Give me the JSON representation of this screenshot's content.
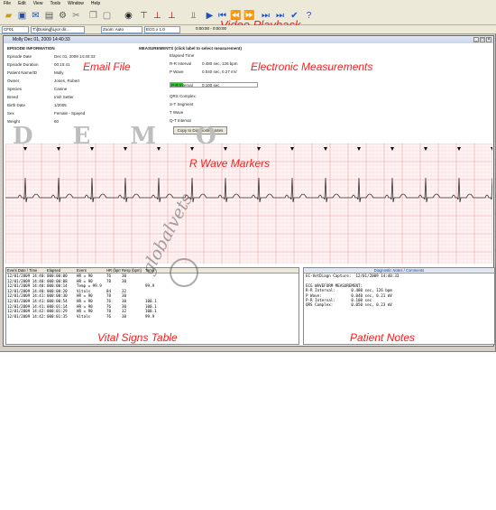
{
  "menu": [
    "File",
    "Edit",
    "View",
    "Tools",
    "Window",
    "Help"
  ],
  "annotations": {
    "video": "Video Playback",
    "email": "Email File",
    "measurements": "Electronic Measurements",
    "rwave": "R Wave Markers",
    "vitals": "Vital Signs Table",
    "notes": "Patient Notes"
  },
  "addressbar": {
    "box1": "CF01",
    "box2": "T:\\[Dosing]\\Lyor dir...",
    "box3": "Zoom: Auto",
    "box4": "ECG x 1.0",
    "time": "0:00:00 - 0:00:00"
  },
  "window": {
    "title": "Molly Dec 01, 2009 14:40:33"
  },
  "episode": {
    "heading": "EPISODE INFORMATION",
    "fields": [
      {
        "label": "Episode Date",
        "value": "Dec 01, 2009 14:40:33"
      },
      {
        "label": "Episode Duration",
        "value": "00:10:41"
      },
      {
        "label": "Patient Name/ID",
        "value": "Molly"
      },
      {
        "label": "Owner",
        "value": "Jones, Robert"
      },
      {
        "label": "Species",
        "value": "Canine"
      },
      {
        "label": "Breed",
        "value": "Irish Setter"
      },
      {
        "label": "Birth Date",
        "value": "1/2005"
      },
      {
        "label": "Sex",
        "value": "Female - Spayed"
      },
      {
        "label": "Weight",
        "value": "60"
      }
    ]
  },
  "measurements": {
    "heading": "MEASUREMENTS (click label to select measurement)",
    "items": [
      {
        "label": "Elapsed Time",
        "value": ""
      },
      {
        "label": "R-R Interval",
        "value": "0.480 sec, 126 bpm"
      },
      {
        "label": "P Wave",
        "value": "0.040 sec, 0.27 mV"
      },
      {
        "label": "P-R Interval",
        "value": "0.100 sec"
      },
      {
        "label": "QRS Complex",
        "value": ""
      },
      {
        "label": "S-T Segment",
        "value": ""
      },
      {
        "label": "T Wave",
        "value": ""
      },
      {
        "label": "Q-T Interval",
        "value": ""
      }
    ],
    "copy_button": "Copy to Diagnostic Notes"
  },
  "demo_text": "DEMO",
  "vitals": {
    "headers": [
      "Event Date / Time",
      "Elapsed",
      "Event",
      "HR (bpm)",
      "Resp (bpm)",
      "Temp"
    ],
    "rows": [
      [
        "12/01/2009 14:40:33",
        "000:00:00",
        "HR = 90",
        "76",
        "30",
        ""
      ],
      [
        "12/01/2009 14:40:39",
        "000:00:08",
        "HR = 90",
        "78",
        "30",
        ""
      ],
      [
        "12/01/2009 14:40:48",
        "000:00:14",
        "Temp = 99.9",
        "",
        "",
        "99.9"
      ],
      [
        "12/01/2009 14:40:54",
        "000:00:20",
        "Vitals",
        "84",
        "32",
        ""
      ],
      [
        "12/01/2009 14:41:03",
        "000:00:30",
        "HR = 90",
        "78",
        "30",
        ""
      ],
      [
        "12/01/2009 14:41:27",
        "000:00:54",
        "HR = 90",
        "76",
        "30",
        "100.1"
      ],
      [
        "12/01/2009 14:41:48",
        "000:01:14",
        "HR = 90",
        "76",
        "30",
        "100.1"
      ],
      [
        "12/01/2009 14:42:02",
        "000:01:29",
        "HR = 90",
        "78",
        "32",
        "100.1"
      ],
      [
        "12/01/2009 14:42:08",
        "000:01:35",
        "Vitals",
        "76",
        "30",
        "99.9"
      ]
    ]
  },
  "notes": {
    "heading": "Diagnostic Notes / Comments",
    "lines": [
      "EC-VetDiagn Capture:  12/01/2009 14:40:33",
      "",
      "ECG WAVEFORM MEASUREMENT:",
      "R-R Interval:       0.480 sec, 126 bpm",
      "P Wave:             0.040 sec, 0.21 mV",
      "P-R Interval:       0.100 sec",
      "QRS Complex:        0.050 sec, 0.23 mV"
    ]
  },
  "watermark": "globalvets",
  "colors": {
    "annotation": "#ff1a1a",
    "grid_minor": "#f6c6c6",
    "grid_major": "#ec9a9a",
    "trace": "#333333",
    "measure_bar": "#2ec82e"
  }
}
